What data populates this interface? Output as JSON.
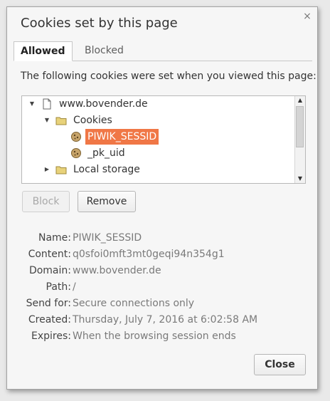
{
  "dialog": {
    "title": "Cookies set by this page",
    "close_glyph": "×"
  },
  "tabs": [
    {
      "label": "Allowed",
      "active": true
    },
    {
      "label": "Blocked",
      "active": false
    }
  ],
  "intro_text": "The following cookies were set when you viewed this page:",
  "tree": {
    "items": [
      {
        "label": "www.bovender.de",
        "icon": "page-icon",
        "twisty": "▼",
        "selected": false
      },
      {
        "label": "Cookies",
        "icon": "folder-icon",
        "twisty": "▼",
        "selected": false
      },
      {
        "label": "PIWIK_SESSID",
        "icon": "cookie-icon",
        "twisty": "",
        "selected": true
      },
      {
        "label": "_pk_uid",
        "icon": "cookie-icon",
        "twisty": "",
        "selected": false
      },
      {
        "label": "Local storage",
        "icon": "folder-icon",
        "twisty": "▶",
        "selected": false
      }
    ],
    "scroll_up": "▲",
    "scroll_down": "▼"
  },
  "actions": {
    "block_label": "Block",
    "remove_label": "Remove",
    "close_label": "Close"
  },
  "details": [
    {
      "label": "Name:",
      "value": "PIWIK_SESSID"
    },
    {
      "label": "Content:",
      "value": "q0sfoi0mft3mt0geqi94n354g1"
    },
    {
      "label": "Domain:",
      "value": "www.bovender.de"
    },
    {
      "label": "Path:",
      "value": "/"
    },
    {
      "label": "Send for:",
      "value": "Secure connections only"
    },
    {
      "label": "Created:",
      "value": "Thursday, July 7, 2016 at 6:02:58 AM"
    },
    {
      "label": "Expires:",
      "value": "When the browsing session ends"
    }
  ],
  "colors": {
    "selection": "#f07746",
    "folder": "#e8d27a",
    "cookie": "#c7a46a"
  }
}
